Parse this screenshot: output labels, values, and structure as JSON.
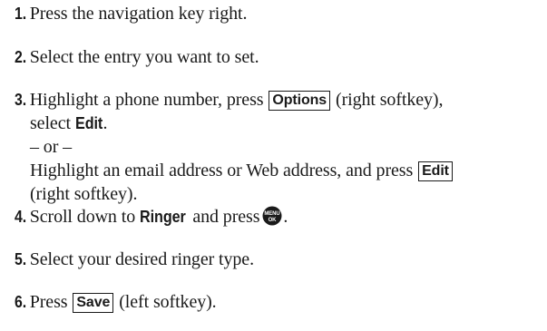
{
  "steps": [
    {
      "num": "1.",
      "text": "Press the navigation key right."
    },
    {
      "num": "2.",
      "text": "Select the entry you want to set."
    },
    {
      "num": "3.",
      "a_pre": "Highlight a phone number, press",
      "a_key": "Options",
      "a_mid": "(right softkey),",
      "a_pre2": "select",
      "a_bold": "Edit",
      "a_end": ".",
      "or": "– or –",
      "b_pre": "Highlight an email address or Web address, and press",
      "b_key": "Edit",
      "b_end": "(right softkey)."
    },
    {
      "num": "4.",
      "pre": "Scroll down to",
      "bold": "Ringer",
      "mid": "and press",
      "icon": "menu-ok-icon",
      "icon_top": "MENU",
      "icon_bottom": "OK",
      "end": "."
    },
    {
      "num": "5.",
      "text": "Select your desired ringer type."
    },
    {
      "num": "6.",
      "pre": "Press",
      "key": "Save",
      "end": "(left softkey)."
    }
  ]
}
